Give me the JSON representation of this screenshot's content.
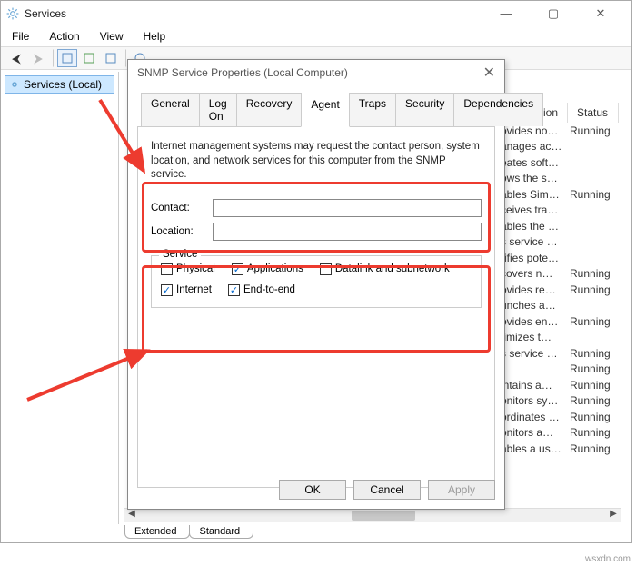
{
  "window": {
    "title": "Services",
    "menu": {
      "file": "File",
      "action": "Action",
      "view": "View",
      "help": "Help"
    },
    "tree_item": "Services (Local)",
    "columns": {
      "description": "scription",
      "status": "Status"
    },
    "bottom_tabs": {
      "extended": "Extended",
      "standard": "Standard"
    }
  },
  "rows": [
    {
      "desc": "ovides no…",
      "status": "Running"
    },
    {
      "desc": "anages ac…",
      "status": ""
    },
    {
      "desc": "eates soft…",
      "status": ""
    },
    {
      "desc": "ows the s…",
      "status": ""
    },
    {
      "desc": "ables Sim…",
      "status": "Running"
    },
    {
      "desc": "ceives tra…",
      "status": ""
    },
    {
      "desc": "ables the …",
      "status": ""
    },
    {
      "desc": "s service …",
      "status": ""
    },
    {
      "desc": "rifies pote…",
      "status": ""
    },
    {
      "desc": "covers n…",
      "status": "Running"
    },
    {
      "desc": "ovides re…",
      "status": "Running"
    },
    {
      "desc": "unches a…",
      "status": ""
    },
    {
      "desc": "ovides en…",
      "status": "Running"
    },
    {
      "desc": "timizes t…",
      "status": ""
    },
    {
      "desc": "s service …",
      "status": "Running"
    },
    {
      "desc": "",
      "status": "Running"
    },
    {
      "desc": "intains a…",
      "status": "Running"
    },
    {
      "desc": "onitors sy…",
      "status": "Running"
    },
    {
      "desc": "ordinates …",
      "status": "Running"
    },
    {
      "desc": "onitors a…",
      "status": "Running"
    },
    {
      "desc": "ables a us…",
      "status": "Running"
    },
    {
      "desc": "",
      "status": ""
    }
  ],
  "dialog": {
    "title": "SNMP Service Properties (Local Computer)",
    "tabs": {
      "general": "General",
      "logon": "Log On",
      "recovery": "Recovery",
      "agent": "Agent",
      "traps": "Traps",
      "security": "Security",
      "dependencies": "Dependencies"
    },
    "desc": "Internet management systems may request the contact person, system location, and network services for this computer from the SNMP service.",
    "contact_label": "Contact:",
    "location_label": "Location:",
    "service_legend": "Service",
    "checks": {
      "physical": "Physical",
      "applications": "Applications",
      "datalink": "Datalink and subnetwork",
      "internet": "Internet",
      "endtoend": "End-to-end"
    },
    "checked": {
      "applications": "✓",
      "internet": "✓",
      "endtoend": "✓"
    },
    "buttons": {
      "ok": "OK",
      "cancel": "Cancel",
      "apply": "Apply"
    }
  },
  "watermark": "wsxdn.com"
}
